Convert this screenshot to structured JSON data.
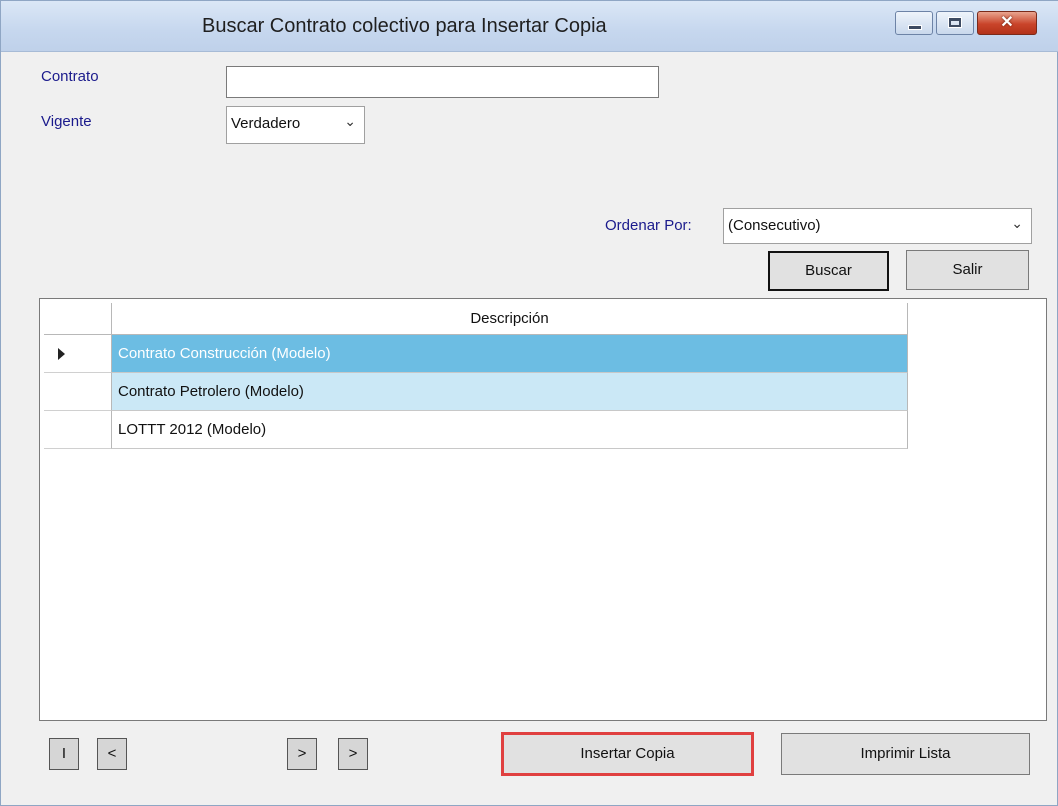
{
  "window": {
    "title": "Buscar Contrato colectivo para Insertar Copia",
    "controls": {
      "minimize": "minimize-icon",
      "maximize": "maximize-icon",
      "close": "✕"
    }
  },
  "form": {
    "contrato_label": "Contrato",
    "contrato_value": "",
    "vigente_label": "Vigente",
    "vigente_value": "Verdadero",
    "ordenar_label": "Ordenar Por:",
    "ordenar_value": "(Consecutivo)"
  },
  "buttons": {
    "buscar": "Buscar",
    "salir": "Salir",
    "insertar": "Insertar Copia",
    "imprimir": "Imprimir Lista"
  },
  "grid": {
    "column_header": "Descripción",
    "rows": [
      "Contrato Construcción (Modelo)",
      "Contrato Petrolero (Modelo)",
      "LOTTT 2012 (Modelo)"
    ]
  },
  "nav": {
    "first": "I",
    "prev": "<",
    "next": ">",
    "last": ">"
  },
  "colors": {
    "selected_row": "#6cbde3",
    "alternate_row": "#cbe8f6",
    "label_text": "#1a1a8c",
    "insert_button_highlight": "#e04040"
  }
}
